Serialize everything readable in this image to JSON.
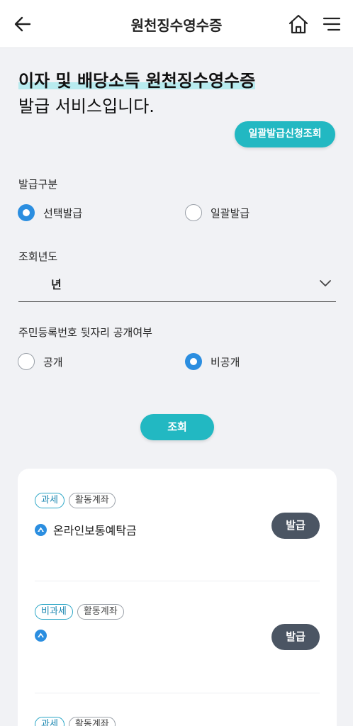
{
  "header": {
    "title": "원천징수영수증",
    "back_icon": "arrow-left-icon",
    "home_icon": "home-icon",
    "menu_icon": "menu-icon"
  },
  "headline": {
    "line1": "이자 및 배당소득 원천징수영수증",
    "line2": "발급 서비스입니다."
  },
  "batch_inquiry_button": "일괄발급신청조회",
  "issue_type": {
    "label": "발급구분",
    "options": [
      {
        "label": "선택발급",
        "selected": true
      },
      {
        "label": "일괄발급",
        "selected": false
      }
    ]
  },
  "year": {
    "label": "조회년도",
    "value": "년"
  },
  "ssn_disclosure": {
    "label": "주민등록번호 뒷자리 공개여부",
    "options": [
      {
        "label": "공개",
        "selected": false
      },
      {
        "label": "비공개",
        "selected": true
      }
    ]
  },
  "search_button": "조회",
  "accounts": [
    {
      "tax_tag": "과세",
      "status_tag": "활동계좌",
      "name": "온라인보통예탁금",
      "issue_label": "발급"
    },
    {
      "tax_tag": "비과세",
      "status_tag": "활동계좌",
      "name": "",
      "issue_label": "발급"
    },
    {
      "tax_tag": "과세",
      "status_tag": "활동계좌"
    }
  ],
  "colors": {
    "accent": "#22b8c2",
    "radio_on": "#2b8ee0",
    "issue_button": "#4b5563",
    "highlight": "#b8ebef"
  }
}
